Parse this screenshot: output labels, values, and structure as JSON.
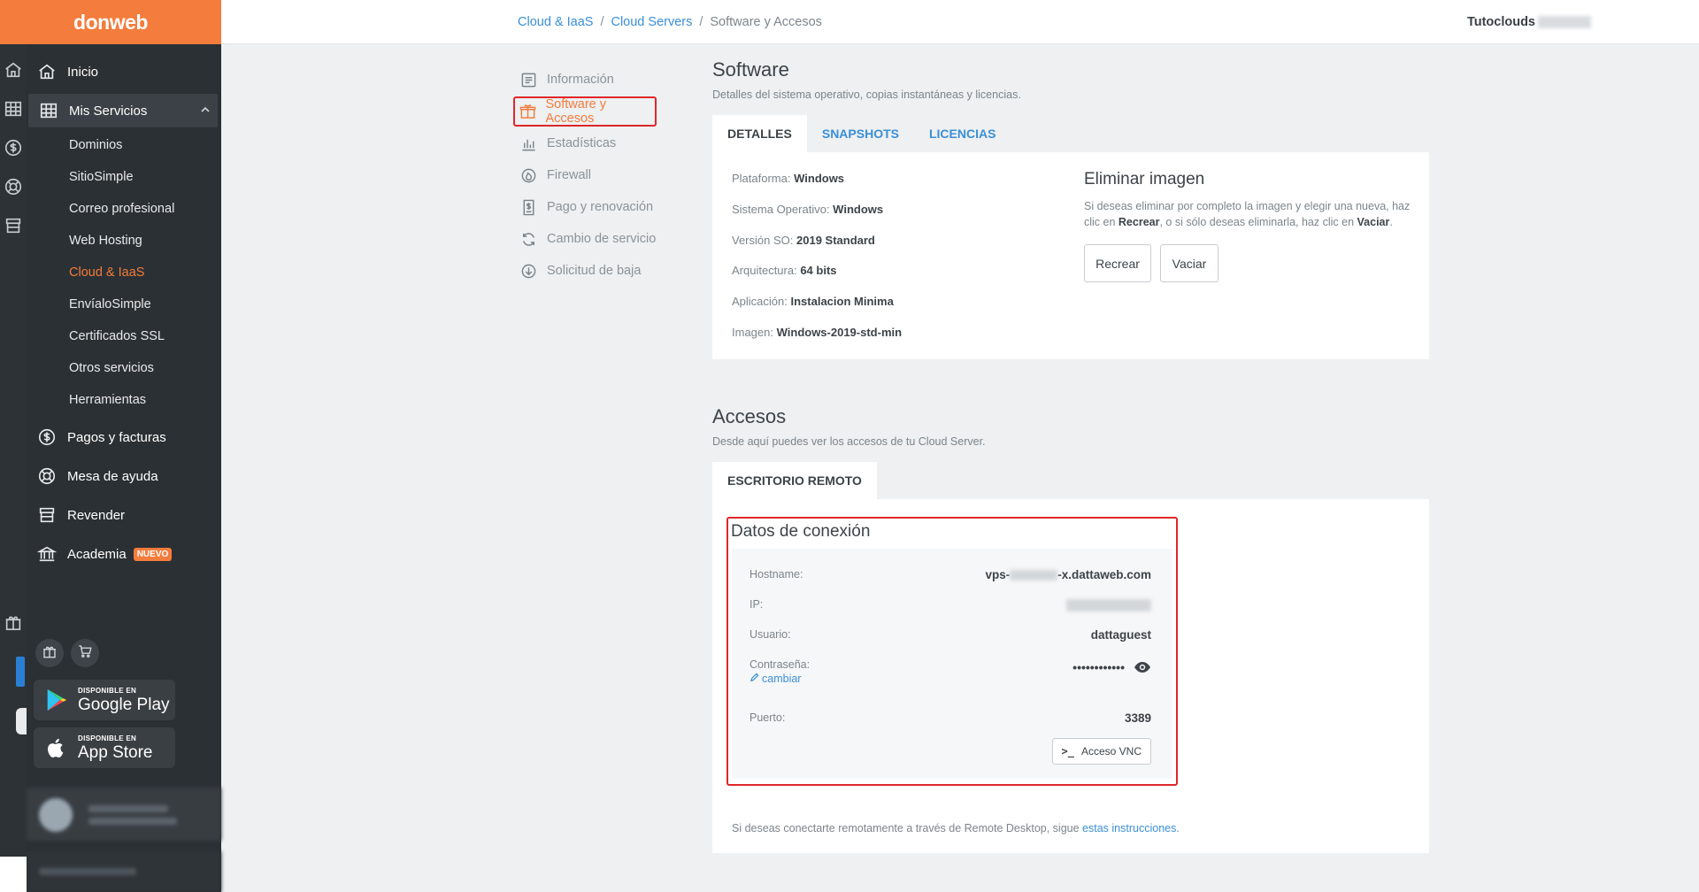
{
  "brand": {
    "logo": "donweb",
    "accent": "#f47c3c"
  },
  "breadcrumb": {
    "items": [
      "Cloud & IaaS",
      "Cloud Servers"
    ],
    "current": "Software y Accesos",
    "separator": "/"
  },
  "account": {
    "name": "Tutoclouds"
  },
  "sidebar": {
    "items": [
      {
        "label": "Inicio",
        "icon": "home-icon"
      },
      {
        "label": "Mis Servicios",
        "icon": "grid-icon",
        "expanded": true
      }
    ],
    "services": [
      "Dominios",
      "SitioSimple",
      "Correo profesional",
      "Web Hosting",
      "Cloud & IaaS",
      "EnvíaloSimple",
      "Certificados SSL",
      "Otros servicios",
      "Herramientas"
    ],
    "current_service": "Cloud & IaaS",
    "more": [
      {
        "label": "Pagos y facturas",
        "icon": "dollar-circle-icon"
      },
      {
        "label": "Mesa de ayuda",
        "icon": "lifebuoy-icon"
      },
      {
        "label": "Revender",
        "icon": "store-icon"
      },
      {
        "label": "Academia",
        "icon": "academy-icon",
        "badge": "NUEVO"
      }
    ],
    "stores": [
      {
        "small": "DISPONIBLE EN",
        "big": "Google Play"
      },
      {
        "small": "DISPONIBLE EN",
        "big": "App Store"
      }
    ]
  },
  "submenu": {
    "items": [
      "Información",
      "Software y Accesos",
      "Estadísticas",
      "Firewall",
      "Pago y renovación",
      "Cambio de servicio",
      "Solicitud de baja"
    ],
    "current": "Software y Accesos"
  },
  "software": {
    "title": "Software",
    "description": "Detalles del sistema operativo, copias instantáneas y licencias.",
    "tabs": [
      "DETALLES",
      "SNAPSHOTS",
      "LICENCIAS"
    ],
    "active_tab": "DETALLES",
    "details": [
      {
        "label": "Plataforma:",
        "value": "Windows"
      },
      {
        "label": "Sistema Operativo:",
        "value": "Windows"
      },
      {
        "label": "Versión SO:",
        "value": "2019 Standard"
      },
      {
        "label": "Arquitectura:",
        "value": "64 bits"
      },
      {
        "label": "Aplicación:",
        "value": "Instalacion Minima"
      },
      {
        "label": "Imagen:",
        "value": "Windows-2019-std-min"
      }
    ],
    "delete_image": {
      "title": "Eliminar imagen",
      "text_1": "Si deseas eliminar por completo la imagen y elegir una nueva, haz clic en ",
      "recreate_word": "Recrear",
      "text_2": ", o si sólo deseas eliminarla, haz clic en ",
      "empty_word": "Vaciar",
      "text_3": ".",
      "recreate_label": "Recrear",
      "empty_label": "Vaciar"
    }
  },
  "access": {
    "title": "Accesos",
    "description": "Desde aquí puedes ver los accesos de tu Cloud Server.",
    "tab": "ESCRITORIO REMOTO",
    "connection": {
      "title": "Datos de conexión",
      "hostname_label": "Hostname:",
      "hostname_prefix": "vps-",
      "hostname_suffix": "-x.dattaweb.com",
      "ip_label": "IP:",
      "user_label": "Usuario:",
      "user_value": "dattaguest",
      "password_label": "Contraseña:",
      "password_value": "••••••••••••",
      "change_label": "cambiar",
      "port_label": "Puerto:",
      "port_value": "3389",
      "vnc_label": "Acceso VNC"
    },
    "footnote_text": "Si deseas conectarte remotamente a través de Remote Desktop, sigue ",
    "footnote_link": "estas instrucciones",
    "footnote_end": "."
  }
}
